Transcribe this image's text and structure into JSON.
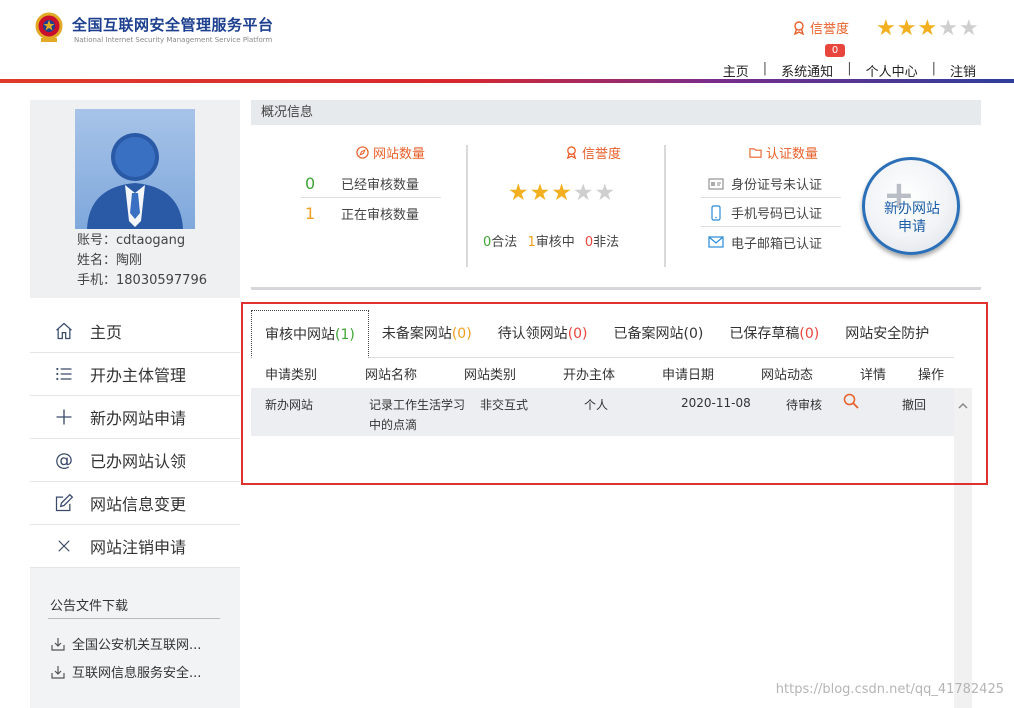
{
  "brand": {
    "title_cn": "全国互联网安全管理服务平台",
    "title_en": "National Internet Security Management Service Platform"
  },
  "header": {
    "credit_label": "信誉度",
    "stars": {
      "filled": 3,
      "total": 5
    },
    "notify_count": "0",
    "nav": [
      "主页",
      "系统通知",
      "个人中心",
      "注销"
    ]
  },
  "profile": {
    "account": "账号：cdtaogang",
    "name": "姓名：陶刚",
    "phone": "手机：18030597796"
  },
  "side_menu": [
    {
      "label": "主页",
      "icon": "home-icon"
    },
    {
      "label": "开办主体管理",
      "icon": "list-icon"
    },
    {
      "label": "新办网站申请",
      "icon": "plus-icon"
    },
    {
      "label": "已办网站认领",
      "icon": "at-icon"
    },
    {
      "label": "网站信息变更",
      "icon": "edit-icon"
    },
    {
      "label": "网站注销申请",
      "icon": "close-icon"
    }
  ],
  "notices": {
    "title": "公告文件下载",
    "items": [
      "全国公安机关互联网...",
      "互联网信息服务安全..."
    ]
  },
  "overview": {
    "title": "概况信息",
    "site_count": {
      "title": "网站数量",
      "rows": [
        {
          "num": "0",
          "label": "已经审核数量"
        },
        {
          "num": "1",
          "label": "正在审核数量"
        }
      ]
    },
    "credit": {
      "title": "信誉度",
      "stars": {
        "filled": 3,
        "total": 5
      },
      "legal": "0",
      "legal_label": "合法",
      "reviewing": "1",
      "reviewing_label": "审核中",
      "illegal": "0",
      "illegal_label": "非法"
    },
    "auth": {
      "title": "认证数量",
      "rows": [
        "身份证号未认证",
        "手机号码已认证",
        "电子邮箱已认证"
      ]
    },
    "new_site_button": "新办网站申请"
  },
  "tabs": [
    {
      "label": "审核中网站",
      "count": "(1)",
      "color": "green"
    },
    {
      "label": "未备案网站",
      "count": "(0)",
      "color": "orange"
    },
    {
      "label": "待认领网站",
      "count": "(0)",
      "color": "red"
    },
    {
      "label": "已备案网站",
      "count": "(0)",
      "color": "dark"
    },
    {
      "label": "已保存草稿",
      "count": "(0)",
      "color": "red"
    },
    {
      "label": "网站安全防护",
      "count": "",
      "color": "dark"
    }
  ],
  "table": {
    "columns": [
      "申请类别",
      "网站名称",
      "网站类别",
      "开办主体",
      "申请日期",
      "网站动态",
      "详情",
      "操作"
    ],
    "rows": [
      {
        "category": "新办网站",
        "site_name_line1": "记录工作生活学习",
        "site_name_line2": "中的点滴",
        "site_type": "非交互式",
        "owner": "个人",
        "date": "2020-11-08",
        "status": "待审核",
        "action": "撤回"
      }
    ]
  },
  "footer": {
    "url": "https://blog.csdn.net/qq_41782425"
  }
}
